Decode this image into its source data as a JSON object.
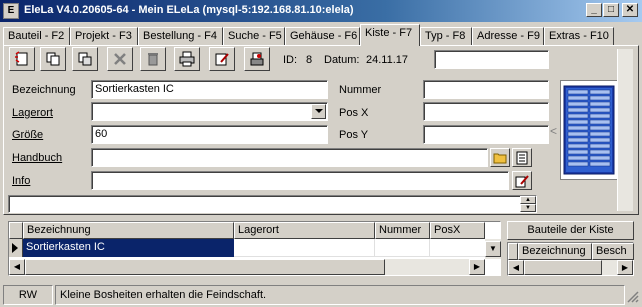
{
  "window": {
    "title": "EleLa V4.0.20605-64  - Mein ELeLa (mysql-5:192.168.81.10:elela)",
    "minimize": "_",
    "maximize": "□",
    "close": "✕"
  },
  "tabs": [
    {
      "label": "Bauteil - F2"
    },
    {
      "label": "Projekt - F3"
    },
    {
      "label": "Bestellung - F4"
    },
    {
      "label": "Suche - F5"
    },
    {
      "label": "Gehäuse - F6"
    },
    {
      "label": "Kiste - F7",
      "active": true
    },
    {
      "label": "Typ - F8"
    },
    {
      "label": "Adresse - F9"
    },
    {
      "label": "Extras - F10"
    }
  ],
  "toolbar": {
    "icons": [
      "new-icon",
      "copy-icon",
      "duplicate-icon",
      "delete-icon",
      "trash-icon",
      "print-icon",
      "edit-icon",
      "label-print-icon"
    ],
    "id_label": "ID:",
    "id_value": "8",
    "datum_label": "Datum:",
    "datum_value": "24.11.17"
  },
  "form": {
    "bezeichnung_label": "Bezeichnung",
    "bezeichnung_value": "Sortierkasten IC",
    "lagerort_label": "Lagerort",
    "lagerort_value": "",
    "groesse_label": "Größe",
    "groesse_value": "60",
    "handbuch_label": "Handbuch",
    "handbuch_value": "",
    "info_label": "Info",
    "info_value": "",
    "nummer_label": "Nummer",
    "nummer_value": "",
    "posx_label": "Pos X",
    "posx_value": "",
    "posy_label": "Pos Y",
    "posy_value": "",
    "notes_value": ""
  },
  "image_nav": {
    "prev": "<",
    "next": ">"
  },
  "grid": {
    "columns": [
      "Bezeichnung",
      "Lagerort",
      "Nummer",
      "PosX"
    ],
    "rows": [
      {
        "bezeichnung": "Sortierkasten IC",
        "lagerort": "",
        "nummer": "",
        "posx": ""
      }
    ]
  },
  "parts_panel": {
    "button_label": "Bauteile der Kiste",
    "columns": [
      "Bezeichnung",
      "Besch"
    ]
  },
  "status": {
    "mode": "RW",
    "message": "Kleine Bosheiten erhalten die Feindschaft."
  },
  "colors": {
    "title_active": "#0a246a",
    "selection": "#0a246a",
    "face": "#d4d0c8"
  }
}
